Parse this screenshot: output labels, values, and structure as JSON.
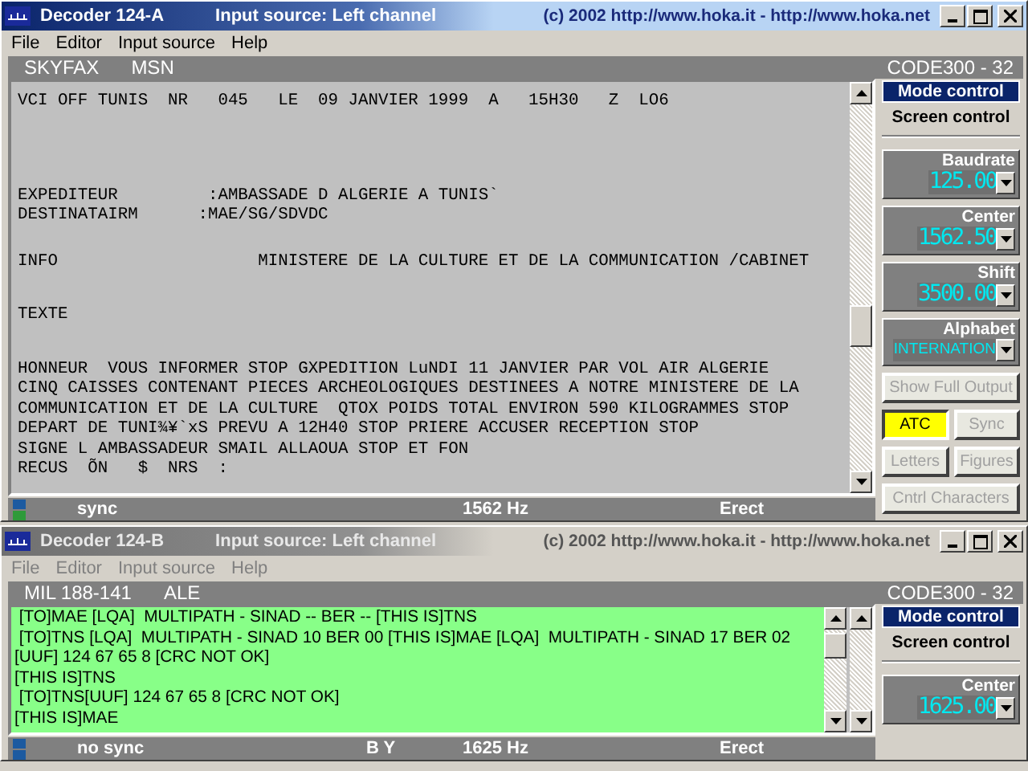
{
  "windows": [
    {
      "title": "Decoder 124-A",
      "input_source": "Input source: Left channel",
      "copyright": "(c) 2002  http://www.hoka.it   -   http://www.hoka.net",
      "active": true,
      "menu": [
        "File",
        "Editor",
        "Input source",
        "Help"
      ],
      "header": {
        "mode": "SKYFAX",
        "protocol": "MSN",
        "code": "CODE300 - 32"
      },
      "output": {
        "kind": "teletype",
        "blocks": [
          [
            "VCI OFF TUNIS  NR   045   LE  09 JANVIER 1999  A   15H30   Z  LO6"
          ],
          [
            "EXPEDITEUR         :AMBASSADE D ALGERIE A TUNIS`",
            "DESTINATAIRM      :MAE/SG/SDVDC"
          ],
          [
            "INFO                    MINISTERE DE LA CULTURE ET DE LA COMMUNICATION /CABINET"
          ],
          [
            "TEXTE"
          ],
          [
            "HONNEUR  VOUS INFORMER STOP GXPEDITION LuNDI 11 JANVIER PAR VOL AIR ALGERIE",
            "CINQ CAISSES CONTENANT PIECES ARCHEOLOGIQUES DESTINEES A NOTRE MINISTERE DE LA",
            "COMMUNICATION ET DE LA CULTURE  QTOX POIDS TOTAL ENVIRON 590 KILOGRAMMES STOP",
            "DEPART DE TUNI¾¥`xS PREVU A 12H40 STOP PRIERE ACCUSER RECEPTION STOP",
            "SIGNE L AMBASSADEUR SMAIL ALLAOUA STOP ET FON",
            "RECUS  ÕN   $  NRS  :"
          ]
        ]
      },
      "panel": {
        "mode_control": "Mode control",
        "screen_control": "Screen control",
        "settings": [
          {
            "kind": "digits",
            "label": "Baudrate",
            "value": "125.00"
          },
          {
            "kind": "digits",
            "label": "Center",
            "value": "1562.50"
          },
          {
            "kind": "digits",
            "label": "Shift",
            "value": "3500.00"
          },
          {
            "kind": "select",
            "label": "Alphabet",
            "value": "INTERNATION"
          }
        ],
        "buttons": [
          [
            {
              "label": "Show Full Output",
              "selected": false,
              "disabled": true
            }
          ],
          [
            {
              "label": "ATC",
              "selected": true,
              "disabled": false
            },
            {
              "label": "Sync",
              "selected": false,
              "disabled": true
            }
          ],
          [
            {
              "label": "Letters",
              "selected": false,
              "disabled": true
            },
            {
              "label": "Figures",
              "selected": false,
              "disabled": true
            }
          ],
          [
            {
              "label": "Cntrl Characters",
              "selected": false,
              "disabled": true
            }
          ]
        ]
      },
      "status": {
        "indicators": [
          {
            "color": "#1c5aa0"
          },
          {
            "color": "#2e9a3a"
          }
        ],
        "sync": "sync",
        "frequency": "1562 Hz",
        "polarity": "Erect"
      }
    },
    {
      "title": "Decoder 124-B",
      "input_source": "Input source: Left channel",
      "copyright": "(c) 2002  http://www.hoka.it   -   http://www.hoka.net",
      "active": false,
      "menu": [
        "File",
        "Editor",
        "Input source",
        "Help"
      ],
      "header": {
        "mode": "MIL 188-141",
        "protocol": "ALE",
        "code": "CODE300 - 32"
      },
      "output": {
        "kind": "ale",
        "blocks": [
          [
            " [TO]MAE [LQA]  MULTIPATH - SINAD -- BER -- [THIS IS]TNS",
            " [TO]TNS [LQA]  MULTIPATH - SINAD 10 BER 00 [THIS IS]MAE [LQA]  MULTIPATH - SINAD 17 BER 02",
            "[UUF] 124 67 65 8 [CRC NOT OK]",
            "[THIS IS]TNS",
            " [TO]TNS[UUF] 124 67 65 8 [CRC NOT OK]",
            "[THIS IS]MAE"
          ]
        ]
      },
      "panel": {
        "mode_control": "Mode control",
        "screen_control": "Screen control",
        "settings": [
          {
            "kind": "digits",
            "label": "Center",
            "value": "1625.00"
          }
        ]
      },
      "status": {
        "indicators": [
          {
            "color": "#1c5aa0"
          },
          {
            "color": "#1c5aa0"
          }
        ],
        "sync": "no sync",
        "mode": "B Y",
        "frequency": "1625 Hz",
        "polarity": "Erect"
      }
    }
  ]
}
